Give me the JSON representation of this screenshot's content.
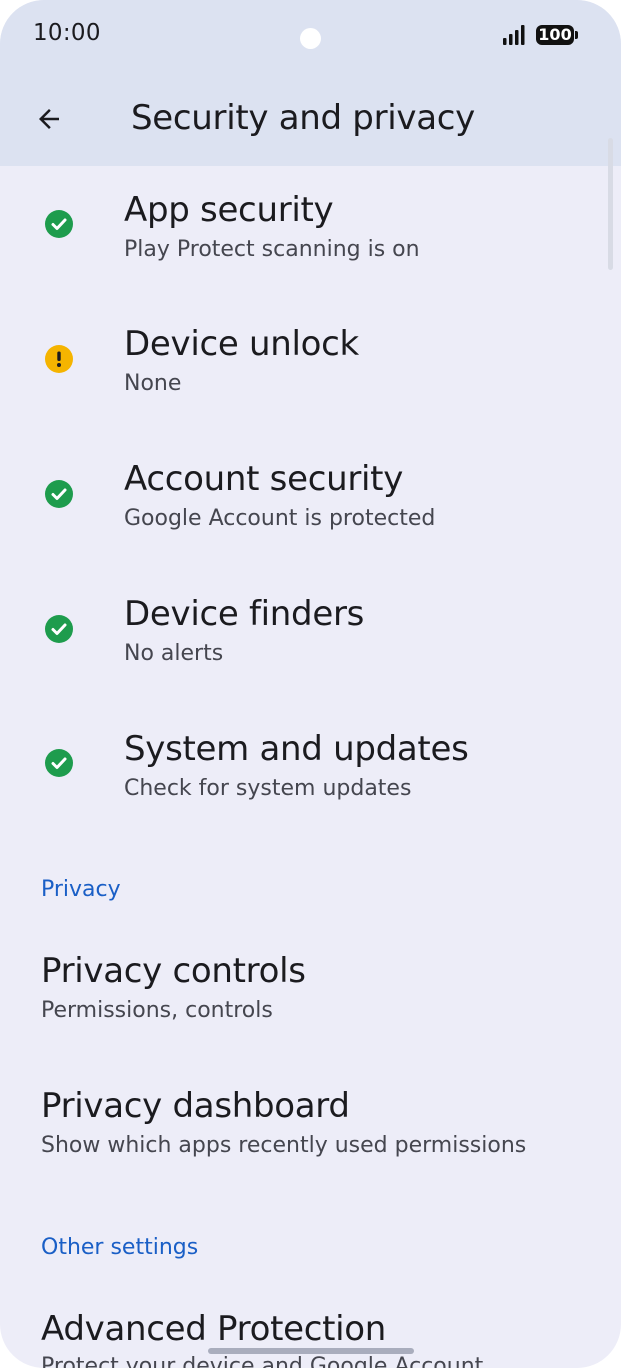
{
  "status_bar": {
    "time": "10:00",
    "battery": "100"
  },
  "app_bar": {
    "title": "Security and privacy"
  },
  "security_items": [
    {
      "title": "App security",
      "subtitle": "Play Protect scanning is on",
      "status": "ok"
    },
    {
      "title": "Device unlock",
      "subtitle": "None",
      "status": "warning"
    },
    {
      "title": "Account security",
      "subtitle": "Google Account is protected",
      "status": "ok"
    },
    {
      "title": "Device finders",
      "subtitle": "No alerts",
      "status": "ok"
    },
    {
      "title": "System and updates",
      "subtitle": "Check for system updates",
      "status": "ok"
    }
  ],
  "privacy_section": {
    "header": "Privacy",
    "items": [
      {
        "title": "Privacy controls",
        "subtitle": "Permissions, controls"
      },
      {
        "title": "Privacy dashboard",
        "subtitle": "Show which apps recently used permissions"
      }
    ]
  },
  "other_section": {
    "header": "Other settings",
    "items": [
      {
        "title": "Advanced Protection",
        "subtitle": "Protect your device and Google Account"
      }
    ]
  },
  "colors": {
    "ok": "#1e9c4d",
    "warning": "#f5b400",
    "accent": "#1a5fc6",
    "background": "#ededf8",
    "app_bar": "#dce2f1"
  },
  "icons": {
    "back": "arrow-left-icon",
    "ok": "check-circle-icon",
    "warning": "exclamation-circle-icon"
  }
}
